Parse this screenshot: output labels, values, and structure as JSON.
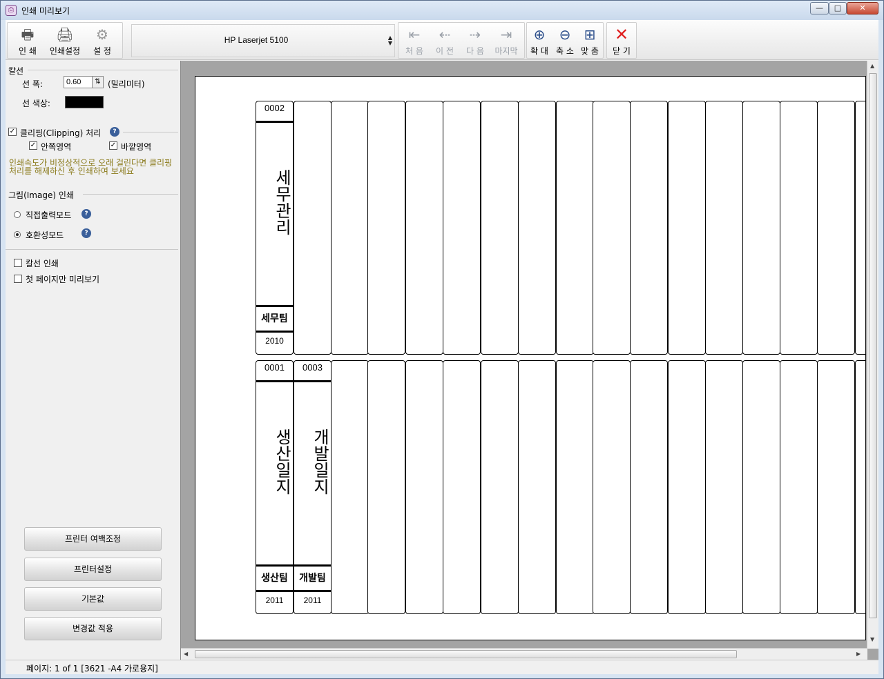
{
  "window": {
    "title": "인쇄 미리보기",
    "icon": "printer-preview-app-icon",
    "controls": {
      "minimize": "—",
      "maximize": "□",
      "close": "✕"
    }
  },
  "toolbar": {
    "print": {
      "label": "인 쇄",
      "icon": "printer-icon"
    },
    "print_setup": {
      "label": "인쇄설정",
      "icon": "printer-setup-icon"
    },
    "settings": {
      "label": "설 정",
      "icon": "gears-icon"
    },
    "printer": {
      "selected": "HP Laserjet 5100"
    },
    "first": {
      "label": "처 음",
      "icon": "first-page-icon",
      "enabled": false
    },
    "prev": {
      "label": "이 전",
      "icon": "prev-page-icon",
      "enabled": false
    },
    "next": {
      "label": "다 음",
      "icon": "next-page-icon",
      "enabled": false
    },
    "last": {
      "label": "마지막",
      "icon": "last-page-icon",
      "enabled": false
    },
    "zoom_in": {
      "label": "확 대",
      "icon": "zoom-in-icon"
    },
    "zoom_out": {
      "label": "축 소",
      "icon": "zoom-out-icon"
    },
    "fit": {
      "label": "맞 춤",
      "icon": "zoom-fit-icon"
    },
    "close": {
      "label": "닫 기",
      "icon": "close-x-icon",
      "color": "#e02020"
    }
  },
  "left_panel": {
    "ruleline_group": "칼선",
    "line_width_label": "선 폭:",
    "line_width_value": "0.60",
    "line_width_unit": "(밀리미터)",
    "line_color_label": "선 색상:",
    "line_color": "#000000",
    "clipping": {
      "label": "클리핑(Clipping) 처리",
      "checked": true
    },
    "inner_area": {
      "label": "안쪽영역",
      "checked": true
    },
    "outer_area": {
      "label": "바깥영역",
      "checked": true
    },
    "warning": "인쇄속도가 비정상적으로 오래 걸린다면 클리핑처리를 해제하신 후 인쇄하여 보세요",
    "warning_color": "#8a7a1a",
    "image_group": "그림(Image) 인쇄",
    "direct_mode": {
      "label": "직접출력모드",
      "selected": false
    },
    "compat_mode": {
      "label": "호환성모드",
      "selected": true
    },
    "print_ruleline": {
      "label": "칼선 인쇄",
      "checked": false
    },
    "first_page_only": {
      "label": "첫 페이지만 미리보기",
      "checked": false
    },
    "buttons": {
      "margin": "프린터 여백조정",
      "printer_setup": "프린터설정",
      "defaults": "기본값",
      "apply": "변경값 적용"
    }
  },
  "preview": {
    "cards": [
      {
        "number": "0002",
        "name": [
          "세",
          "무",
          "관",
          "리"
        ],
        "team": "세무팀",
        "year": "2010"
      },
      {
        "number": "0001",
        "name": [
          "생",
          "산",
          "일",
          "지"
        ],
        "team": "생산팀",
        "year": "2011"
      },
      {
        "number": "0003",
        "name": [
          "개",
          "발",
          "일",
          "지"
        ],
        "team": "개발팀",
        "year": "2011"
      }
    ]
  },
  "status": {
    "text": "페이지: 1 of 1 [3621 -A4 가로용지]"
  }
}
